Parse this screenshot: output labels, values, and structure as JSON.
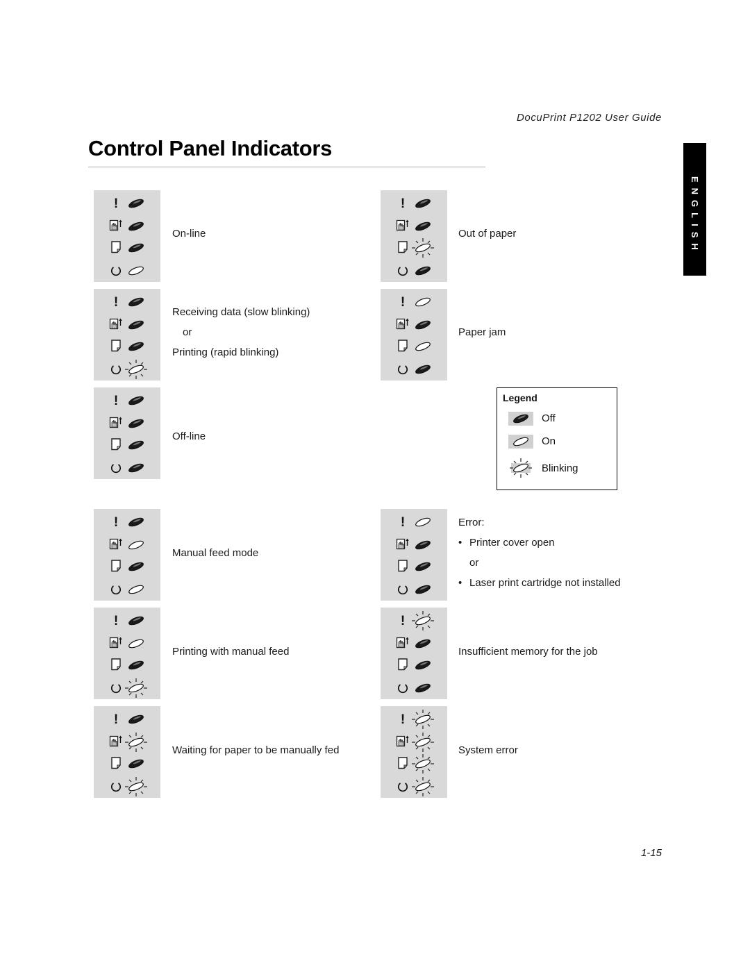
{
  "header": {
    "running_title": "DocuPrint P1202 User Guide",
    "page_title": "Control Panel Indicators",
    "language_tab": "ENGLISH"
  },
  "indicator_order": [
    "error",
    "manual-feed",
    "paper",
    "ready"
  ],
  "colors": {
    "panel_bg": "#d9d9d9",
    "led_off_fill": "#1a1a1a",
    "led_on_fill": "#ffffff",
    "tab_bg": "#000000"
  },
  "left_column": [
    {
      "states": [
        "off",
        "off",
        "off",
        "on"
      ],
      "lines": [
        "On-line"
      ]
    },
    {
      "states": [
        "off",
        "off",
        "off",
        "blinking"
      ],
      "lines": [
        "Receiving data (slow blinking)",
        "or",
        "Printing (rapid blinking)"
      ]
    },
    {
      "states": [
        "off",
        "off",
        "off",
        "off"
      ],
      "lines": [
        "Off-line"
      ]
    },
    {
      "states": [
        "off",
        "on",
        "off",
        "on"
      ],
      "lines": [
        "Manual feed mode"
      ]
    },
    {
      "states": [
        "off",
        "on",
        "off",
        "blinking"
      ],
      "lines": [
        "Printing with manual feed"
      ]
    },
    {
      "states": [
        "off",
        "blinking",
        "off",
        "blinking"
      ],
      "lines": [
        "Waiting for paper to be manually fed"
      ]
    }
  ],
  "right_column": [
    {
      "states": [
        "off",
        "off",
        "blinking",
        "off"
      ],
      "lines": [
        "Out of paper"
      ]
    },
    {
      "states": [
        "on",
        "off",
        "on",
        "off"
      ],
      "lines": [
        "Paper jam"
      ]
    },
    {
      "states": [
        "on",
        "off",
        "off",
        "off"
      ],
      "lines": [
        "Error:",
        "Printer cover open",
        "or",
        "Laser print cartridge not installed"
      ]
    },
    {
      "states": [
        "blinking",
        "off",
        "off",
        "off"
      ],
      "lines": [
        "Insufficient memory for the job"
      ]
    },
    {
      "states": [
        "blinking",
        "blinking",
        "blinking",
        "blinking"
      ],
      "lines": [
        "System error"
      ]
    }
  ],
  "legend": {
    "title": "Legend",
    "items": [
      {
        "state": "off",
        "label": "Off"
      },
      {
        "state": "on",
        "label": "On"
      },
      {
        "state": "blinking",
        "label": "Blinking"
      }
    ]
  },
  "footer": {
    "page_number": "1-15"
  }
}
